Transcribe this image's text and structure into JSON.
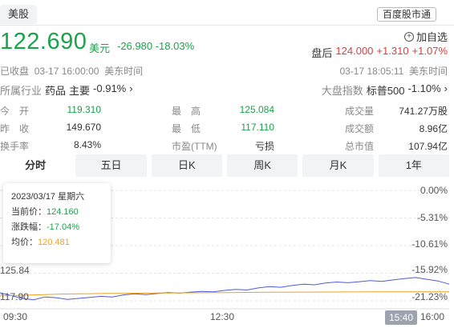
{
  "header": {
    "market_tab": "美股",
    "source_badge": "百度股市通"
  },
  "quote": {
    "price": "122.690",
    "currency": "美元",
    "change": "-26.980",
    "change_pct": "-18.03%",
    "watch_label": "加自选",
    "after_hours_label": "盘后",
    "after_hours_price": "124.000",
    "after_hours_change": "+1.310",
    "after_hours_change_pct": "+1.07%",
    "status": "已收盘",
    "status_time": "03-17 16:00:00",
    "status_tz": "美东时间",
    "ah_time": "03-17 18:05:11",
    "ah_tz": "美东时间"
  },
  "industry": {
    "label": "所属行业",
    "sector": "药品",
    "sub": "主要",
    "pct": "-0.91%",
    "index_label": "大盘指数",
    "index_name": "标普500",
    "index_pct": "-1.10%"
  },
  "stats": [
    {
      "l1": "今　开",
      "v1": "119.310",
      "l2": "最　高",
      "v2": "125.084",
      "l3": "成交量",
      "v3": "741.27万股"
    },
    {
      "l1": "昨　收",
      "v1": "149.670",
      "l2": "最　低",
      "v2": "117.110",
      "l3": "成交额",
      "v3": "8.96亿"
    },
    {
      "l1": "换手率",
      "v1": "8.43%",
      "l2": "市盈(TTM)",
      "v2": "亏损",
      "l3": "总市值",
      "v3": "107.94亿"
    }
  ],
  "periods": [
    "分时",
    "五日",
    "日K",
    "周K",
    "月K",
    "1年"
  ],
  "tooltip": {
    "date": "2023/03/17 星期六",
    "current_label": "当前价：",
    "current_value": "124.160",
    "change_label": "涨跌幅：",
    "change_value": "-17.04%",
    "avg_label": "均价：",
    "avg_value": "120.481"
  },
  "chart_data": {
    "type": "line",
    "x_ticks": [
      "09:30",
      "12:30",
      "16:00"
    ],
    "y_price_labels": [
      "125.84",
      "117.90"
    ],
    "y_pct_labels": [
      "0.00%",
      "-5.31%",
      "-10.61%",
      "-15.92%",
      "-21.23%"
    ],
    "cursor_time": "15:40",
    "ylim": [
      117.9,
      149.67
    ],
    "series": [
      {
        "values": [
          120.2,
          119.4,
          118.6,
          118.2,
          119.0,
          118.8,
          118.3,
          118.6,
          118.9,
          119.2,
          119.0,
          119.6,
          119.9,
          119.7,
          120.0,
          120.3,
          120.1,
          120.4,
          120.6,
          120.5,
          120.9,
          121.2,
          121.0,
          121.6,
          122.0,
          121.8,
          122.3,
          122.7,
          122.5,
          123.0,
          123.3,
          123.1,
          123.4,
          123.7,
          123.5,
          123.9,
          124.3,
          124.6,
          124.1,
          123.6,
          122.7
        ],
        "color": "#4f5bd5"
      },
      {
        "values": [
          119.3,
          119.4,
          119.5,
          119.6,
          119.7,
          119.8,
          119.85,
          119.9,
          119.95,
          120.0,
          120.02,
          120.05,
          120.08,
          120.1,
          120.13,
          120.16,
          120.18,
          120.2,
          120.23,
          120.26,
          120.28,
          120.3,
          120.32,
          120.34,
          120.36,
          120.38,
          120.4,
          120.41,
          120.42,
          120.43,
          120.44,
          120.45,
          120.46,
          120.47,
          120.48,
          120.48,
          120.48,
          120.49,
          120.49,
          120.48,
          120.481
        ],
        "color": "#f0a020"
      }
    ]
  }
}
